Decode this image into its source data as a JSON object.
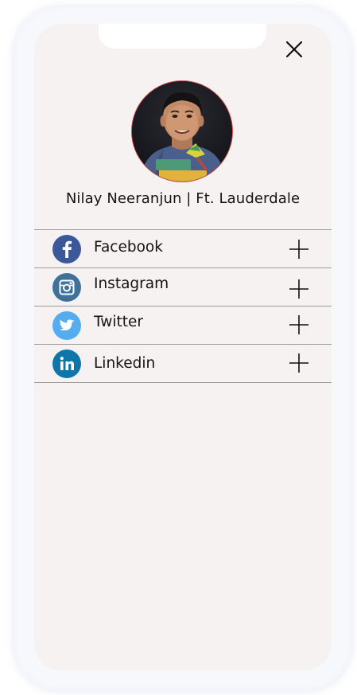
{
  "profile": {
    "name": "Nilay Neeranjun | Ft. Lauderdale",
    "avatar_ring_color": "#d24a4a"
  },
  "header": {
    "close_icon": "close-icon"
  },
  "social_links": [
    {
      "label": "Facebook",
      "icon": "facebook-icon",
      "color": "#3b5998",
      "action_icon": "plus-icon"
    },
    {
      "label": "Instagram",
      "icon": "instagram-icon",
      "color": "#3f729b",
      "action_icon": "plus-icon"
    },
    {
      "label": "Twitter",
      "icon": "twitter-icon",
      "color": "#55acee",
      "action_icon": "plus-icon"
    },
    {
      "label": "Linkedin",
      "icon": "linkedin-icon",
      "color": "#0e76a8",
      "action_icon": "plus-icon"
    }
  ],
  "colors": {
    "screen_background": "#f6f2f1",
    "divider": "#9c9c9c",
    "text": "#141414"
  }
}
